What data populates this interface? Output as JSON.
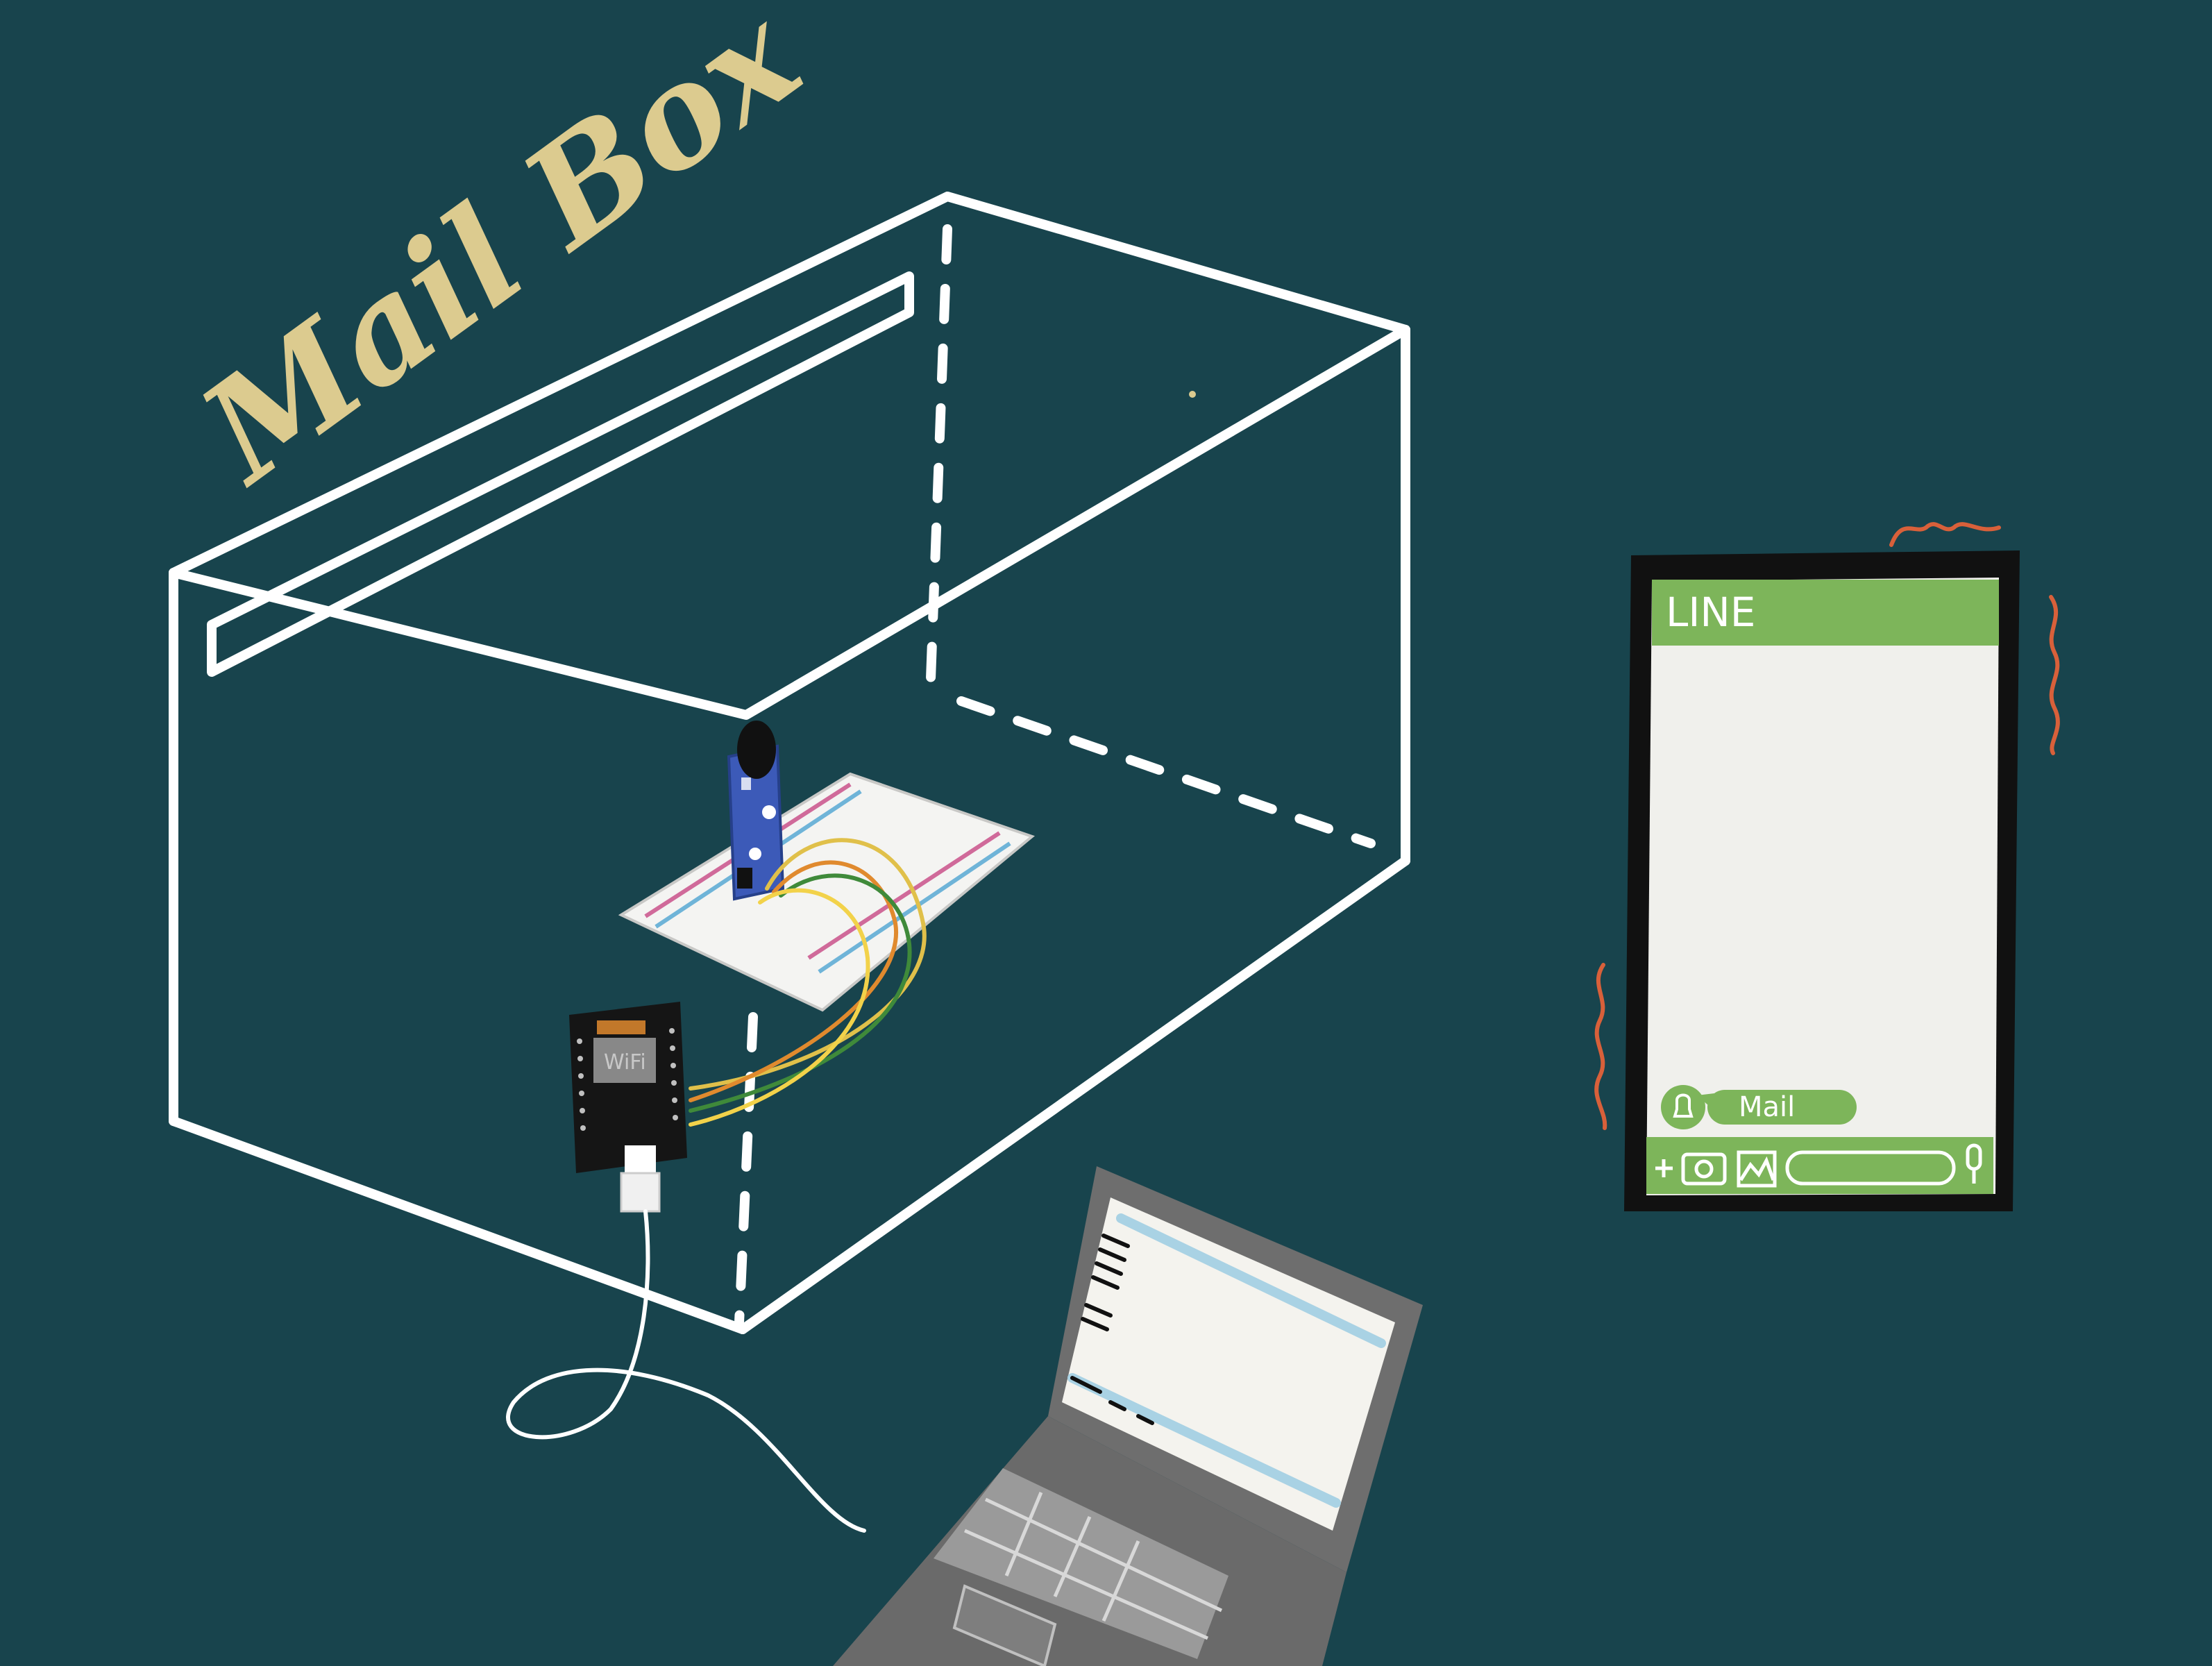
{
  "illustration": {
    "title": "Mail Box",
    "background_color": "#18444d",
    "accent_gold": "#dccb8f",
    "wire_colors": [
      "#e0c04a",
      "#e08a2e",
      "#3f8a3a",
      "#f2d24a"
    ],
    "module_chip_label": "WiFi"
  },
  "phone": {
    "app_name": "LINE",
    "header_color": "#7db55a",
    "message_text": "Mail",
    "toolbar_icons": [
      "plus-icon",
      "camera-icon",
      "image-icon",
      "microphone-icon"
    ],
    "vibration_color": "#d8603a"
  },
  "laptop": {
    "body_color": "#6e6e6e",
    "screen_color": "#f4f3ee"
  }
}
